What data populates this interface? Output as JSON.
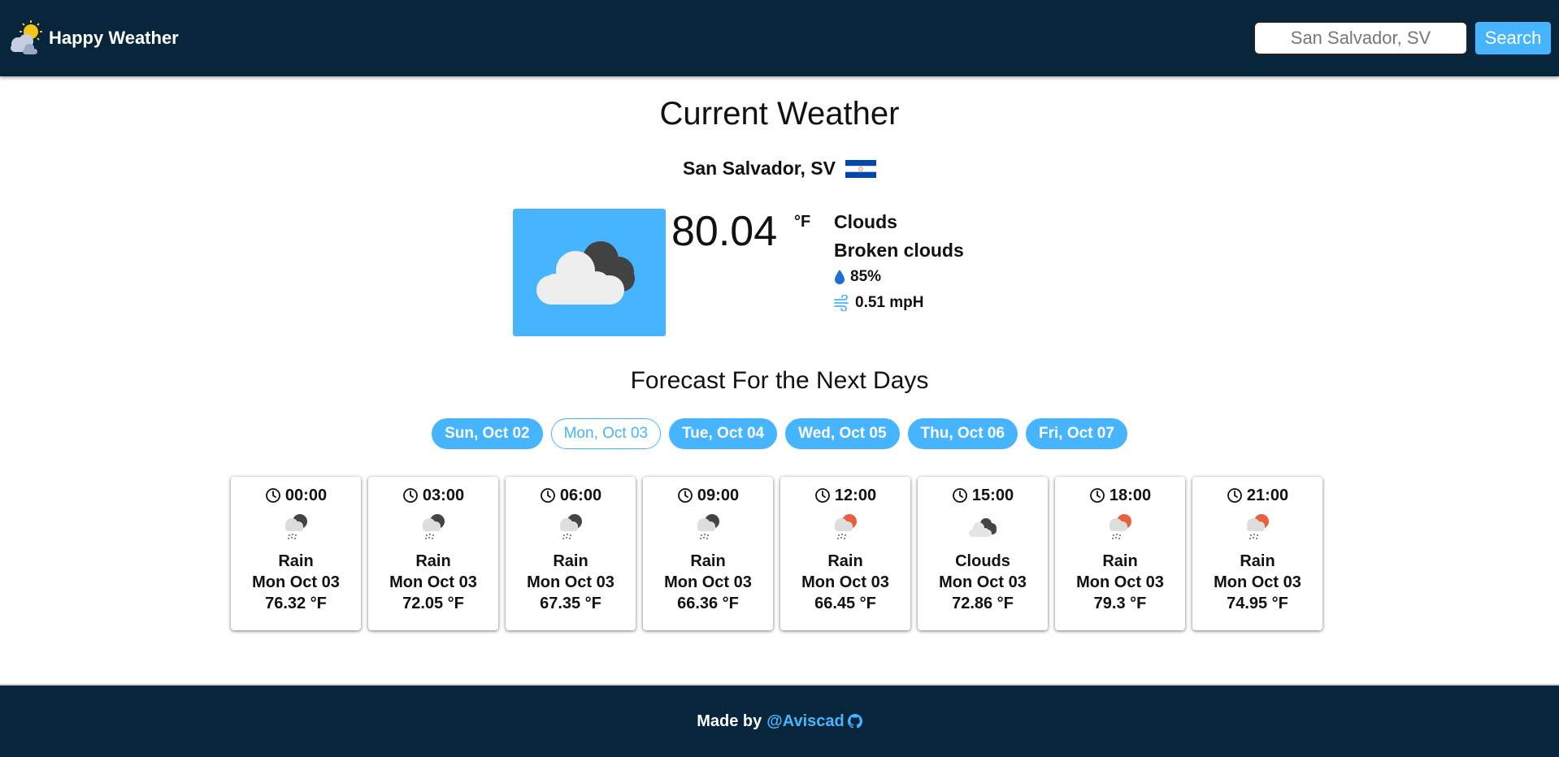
{
  "header": {
    "app_name": "Happy Weather",
    "logo_icon": "sun-behind-cloud-icon",
    "search_placeholder": "San Salvador, SV",
    "search_value": "",
    "search_button_label": "Search"
  },
  "current": {
    "title": "Current Weather",
    "location": "San Salvador, SV",
    "flag_icon": "el-salvador-flag-icon",
    "weather_icon": "broken-clouds-icon",
    "temperature": "80.04",
    "unit": "°F",
    "main": "Clouds",
    "description": "Broken clouds",
    "humidity": "85%",
    "wind": "0.51 mpH"
  },
  "forecast": {
    "title": "Forecast For the Next Days",
    "active_tab": 1,
    "tabs": [
      {
        "label": "Sun, Oct 02"
      },
      {
        "label": "Mon, Oct 03"
      },
      {
        "label": "Tue, Oct 04"
      },
      {
        "label": "Wed, Oct 05"
      },
      {
        "label": "Thu, Oct 06"
      },
      {
        "label": "Fri, Oct 07"
      }
    ],
    "cards": [
      {
        "time": "00:00",
        "icon": "night-rain-icon",
        "condition": "Rain",
        "date": "Mon Oct 03",
        "temp": "76.32 °F"
      },
      {
        "time": "03:00",
        "icon": "night-rain-icon",
        "condition": "Rain",
        "date": "Mon Oct 03",
        "temp": "72.05 °F"
      },
      {
        "time": "06:00",
        "icon": "night-rain-icon",
        "condition": "Rain",
        "date": "Mon Oct 03",
        "temp": "67.35 °F"
      },
      {
        "time": "09:00",
        "icon": "night-rain-icon",
        "condition": "Rain",
        "date": "Mon Oct 03",
        "temp": "66.36 °F"
      },
      {
        "time": "12:00",
        "icon": "day-rain-icon",
        "condition": "Rain",
        "date": "Mon Oct 03",
        "temp": "66.45 °F"
      },
      {
        "time": "15:00",
        "icon": "broken-clouds-icon",
        "condition": "Clouds",
        "date": "Mon Oct 03",
        "temp": "72.86 °F"
      },
      {
        "time": "18:00",
        "icon": "day-rain-icon",
        "condition": "Rain",
        "date": "Mon Oct 03",
        "temp": "79.3 °F"
      },
      {
        "time": "21:00",
        "icon": "day-rain-icon",
        "condition": "Rain",
        "date": "Mon Oct 03",
        "temp": "74.95 °F"
      }
    ]
  },
  "footer": {
    "made_by": "Made by",
    "author": "@Aviscad",
    "author_icon": "github-icon"
  },
  "colors": {
    "navy": "#07263b",
    "accent": "#47b4ff",
    "humidity_blue": "#1d6fd1",
    "sun_orange": "#e8603c"
  }
}
